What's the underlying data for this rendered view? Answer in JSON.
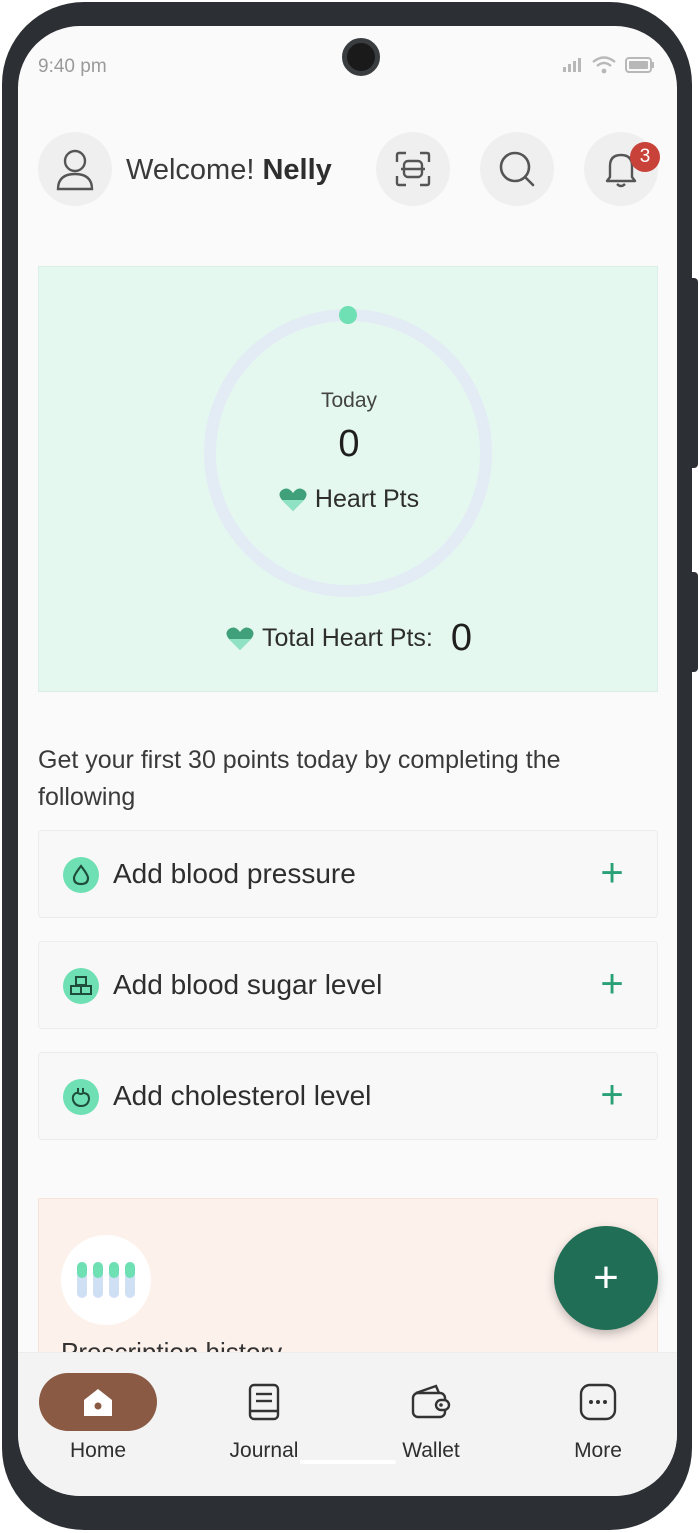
{
  "status_bar": {
    "time": "9:40 pm",
    "icons": [
      "signal-icon",
      "wifi-icon",
      "battery-icon"
    ]
  },
  "header": {
    "welcome_text": "Welcome!",
    "user_name": "Nelly",
    "notification_count": "3",
    "icons": [
      "user-icon",
      "scan-icon",
      "search-icon",
      "bell-icon"
    ]
  },
  "heart_points": {
    "today_label": "Today",
    "today_value": "0",
    "unit_label": "Heart Pts",
    "total_label": "Total Heart Pts:",
    "total_value": "0",
    "progress_fraction": 0
  },
  "tasks": {
    "intro": "Get your first 30 points today by completing the following",
    "items": [
      {
        "label": "Add blood pressure",
        "icon": "blood-drop-icon"
      },
      {
        "label": "Add blood sugar level",
        "icon": "sugar-cubes-icon"
      },
      {
        "label": "Add cholesterol level",
        "icon": "heart-organ-icon"
      }
    ]
  },
  "promo": {
    "title": "Prescription history"
  },
  "fab": {
    "label": "+"
  },
  "bottom_nav": [
    {
      "label": "Home",
      "icon": "home-icon",
      "active": true
    },
    {
      "label": "Journal",
      "icon": "journal-icon",
      "active": false
    },
    {
      "label": "Wallet",
      "icon": "wallet-icon",
      "active": false
    },
    {
      "label": "More",
      "icon": "more-icon",
      "active": false
    }
  ],
  "colors": {
    "accent": "#1f6e55",
    "mint": "#6ee0b4",
    "hero_bg": "#e4f8ef",
    "promo_bg": "#fdf1ec",
    "nav_active": "#8a5a44",
    "badge": "#c8423a"
  }
}
